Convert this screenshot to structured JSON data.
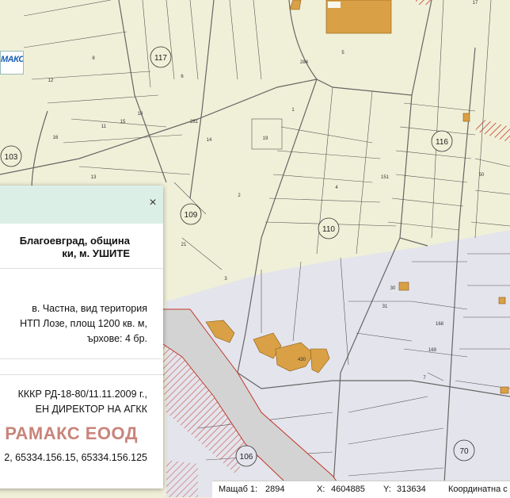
{
  "map": {
    "block_labels": [
      "117",
      "103",
      "109",
      "110",
      "116",
      "106",
      "70"
    ],
    "parcel_labels": [
      "8",
      "6",
      "5",
      "17",
      "1",
      "12",
      "14",
      "16",
      "10",
      "11",
      "15",
      "13",
      "2",
      "21",
      "3",
      "4",
      "19",
      "50",
      "30",
      "31",
      "168",
      "169",
      "430",
      "7",
      "284",
      "281",
      "151"
    ]
  },
  "logo": {
    "text": "МАКС",
    "subtext": ""
  },
  "popup": {
    "title_line1": "Благоевград, община",
    "title_line2": "ки, м. УШИТЕ",
    "description": [
      "в. Частна, вид територия",
      "НТП Лозе, площ 1200 кв. м,",
      "ърхове: 4 бр."
    ],
    "order_line1": "КККР РД-18-80/11.11.2009 г.,",
    "order_line2": "ЕН ДИРЕКТОР НА АГКК",
    "company": "РАМАКС ЕООД",
    "neighbours": "2, 65334.156.15, 65334.156.125",
    "close_label": "×"
  },
  "status_bar": {
    "scale_label": "Мащаб 1:",
    "scale_value": "2894",
    "x_label": "X:",
    "x_value": "4604885",
    "y_label": "Y:",
    "y_value": "313634",
    "coord_label": "Координатна с"
  },
  "colors": {
    "land": "#f0f0d8",
    "urban_zone": "#e4e4ec",
    "building": "#d9a046",
    "road": "#d3d3d3",
    "road_edge": "#c0392b",
    "popup_header": "#dcefe6",
    "company_text": "#c9847a",
    "logo_blue": "#1a5fb4"
  }
}
